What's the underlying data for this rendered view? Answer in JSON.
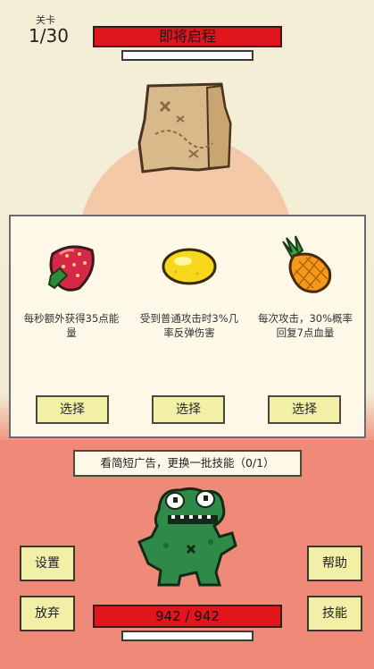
{
  "header": {
    "level_label": "关卡",
    "level_value": "1/30",
    "title": "即将启程"
  },
  "choices": [
    {
      "fruit": "strawberry-icon",
      "desc": "每秒额外获得35点能量",
      "button": "选择"
    },
    {
      "fruit": "lemon-icon",
      "desc": "受到普通攻击时3%几率反弹伤害",
      "button": "选择"
    },
    {
      "fruit": "pineapple-icon",
      "desc": "每次攻击，30%概率回复7点血量",
      "button": "选择"
    }
  ],
  "ad_button": "看简短广告，更换一批技能（0/1）",
  "side_buttons": {
    "settings": "设置",
    "give_up": "放弃",
    "help": "帮助",
    "skills": "技能"
  },
  "player": {
    "hp_text": "942 / 942",
    "hp_fraction": 1.0
  },
  "colors": {
    "bar_red": "#e0151d",
    "button_yellow": "#f2efa6",
    "floor_red": "#f08a78"
  }
}
